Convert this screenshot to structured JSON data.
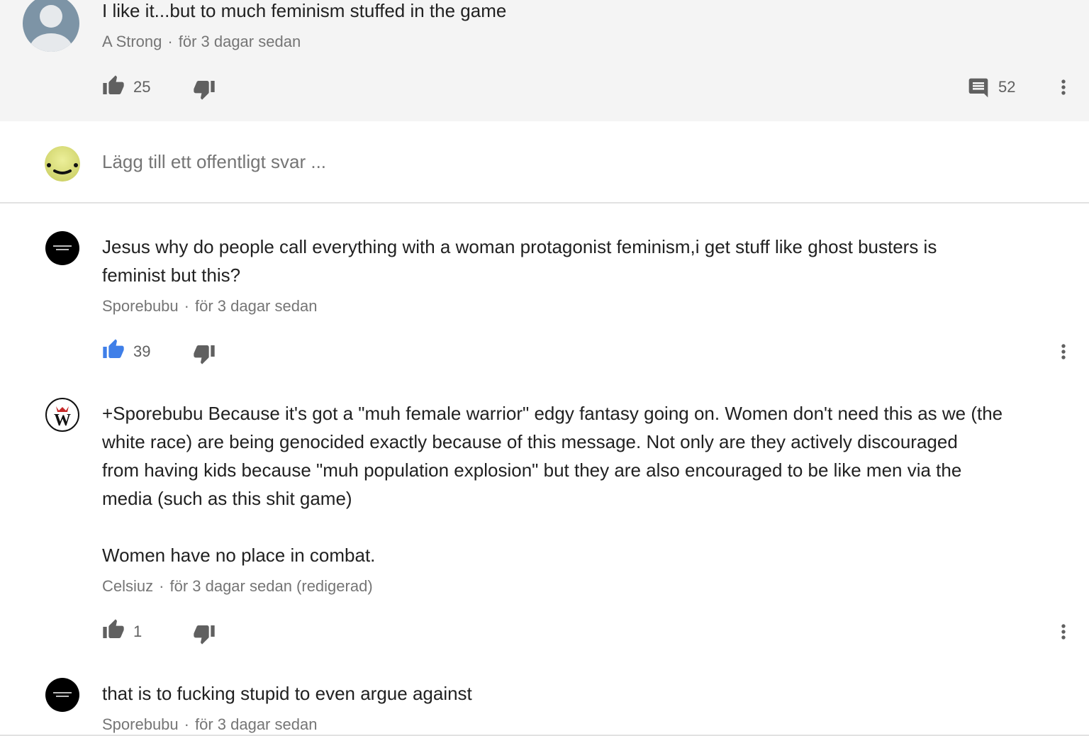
{
  "top_comment": {
    "text": "I like it...but to much feminism stuffed in the game",
    "author": "A Strong",
    "time": "för 3 dagar sedan",
    "likes": "25",
    "replies": "52"
  },
  "reply_box": {
    "placeholder": "Lägg till ett offentligt svar ..."
  },
  "replies": [
    {
      "text_lines": [
        "Jesus why do people call everything with a woman protagonist feminism,i get stuff like ghost busters is",
        "feminist but this?"
      ],
      "author": "Sporebubu",
      "time": "för 3 dagar sedan",
      "likes": "39",
      "liked": true
    },
    {
      "text_lines": [
        "+Sporebubu Because it's got a \"muh female warrior\" edgy fantasy going on. Women don't need this as we (the",
        "white race) are being genocided exactly because of this message. Not only are they actively discouraged",
        "from having kids because \"muh population explosion\" but they are also encouraged to be like men via the",
        "media (such as this shit game)",
        "",
        "Women have no place in combat."
      ],
      "author": "Celsiuz",
      "time": "för 3 dagar sedan (redigerad)",
      "likes": "1",
      "liked": false
    },
    {
      "text_lines": [
        "that is to fucking stupid to even argue against"
      ],
      "author": "Sporebubu",
      "time": "för 3 dagar sedan"
    }
  ],
  "colors": {
    "like_active": "#3f7fe8",
    "icon_default": "#606060",
    "meta_text": "#757575"
  },
  "icons": [
    "thumb-up-icon",
    "thumb-down-icon",
    "comment-icon",
    "more-vert-icon",
    "user-avatar-placeholder"
  ]
}
